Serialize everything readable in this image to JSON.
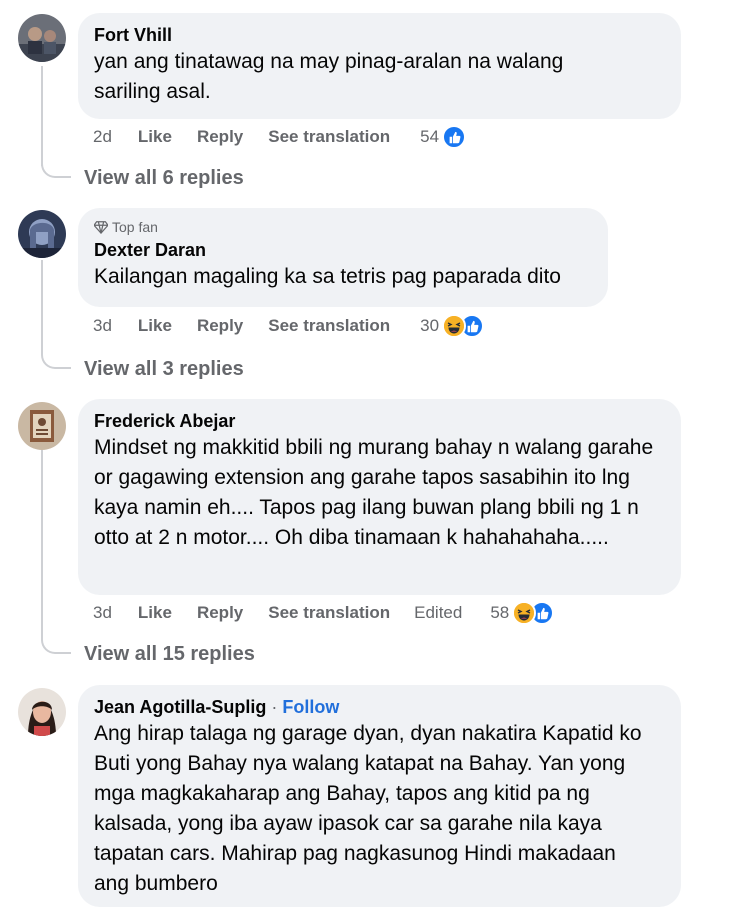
{
  "comments": [
    {
      "name": "Fort Vhill",
      "text": "yan ang tinatawag na may pinag-aralan na walang sariling asal.",
      "time": "2d",
      "like": "Like",
      "reply": "Reply",
      "translate": "See translation",
      "reaction_count": "54",
      "reactions": [
        "like-icon"
      ],
      "view_replies": "View all 6 replies"
    },
    {
      "badge": "Top fan",
      "name": "Dexter Daran",
      "text": "Kailangan magaling ka sa tetris pag paparada dito",
      "time": "3d",
      "like": "Like",
      "reply": "Reply",
      "translate": "See translation",
      "reaction_count": "30",
      "reactions": [
        "haha-icon",
        "like-icon"
      ],
      "view_replies": "View all 3 replies"
    },
    {
      "name": "Frederick Abejar",
      "text": "Mindset ng makkitid bbili ng murang bahay n walang garahe or gagawing extension ang garahe tapos sasabihin ito lng kaya namin eh.... Tapos pag ilang buwan plang bbili ng 1 n otto at 2 n motor.... Oh diba tinamaan k hahahahaha.....",
      "time": "3d",
      "like": "Like",
      "reply": "Reply",
      "translate": "See translation",
      "edited": "Edited",
      "reaction_count": "58",
      "reactions": [
        "haha-icon",
        "like-icon"
      ],
      "view_replies": "View all 15 replies"
    },
    {
      "name": "Jean Agotilla-Suplig",
      "separator": "·",
      "follow": "Follow",
      "text": "Ang hirap talaga ng garage dyan, dyan nakatira Kapatid ko Buti yong Bahay nya walang katapat na Bahay. Yan yong mga magkakaharap ang Bahay, tapos ang kitid pa ng kalsada, yong iba ayaw ipasok car sa garahe nila kaya tapatan cars. Mahirap pag nagkasunog Hindi makadaan ang bumbero"
    }
  ],
  "colors": {
    "bubble": "#f0f2f5",
    "meta": "#65676b",
    "like": "#1877f2",
    "haha": "#f7b125",
    "follow": "#216fdb"
  }
}
